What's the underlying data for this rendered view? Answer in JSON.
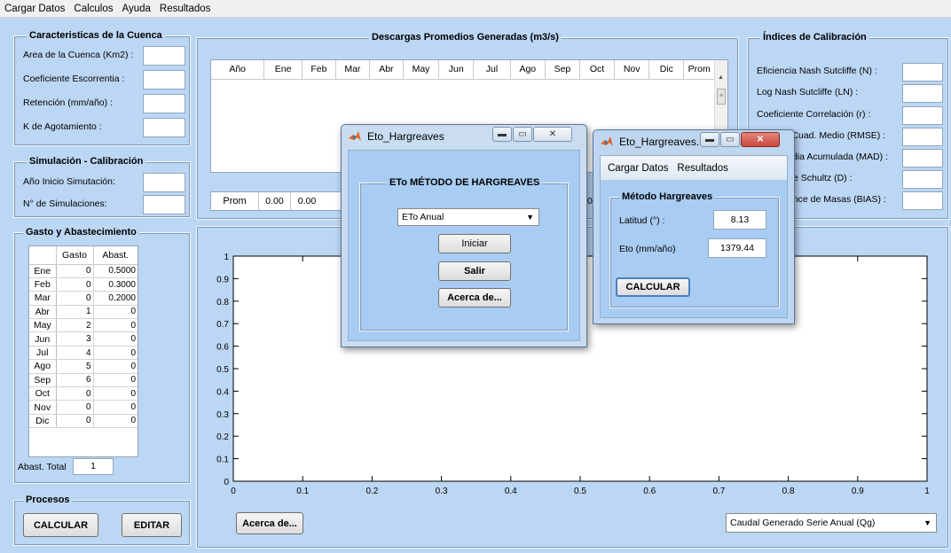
{
  "menubar": [
    "Cargar Datos",
    "Calculos",
    "Ayuda",
    "Resultados"
  ],
  "cuenca": {
    "title": "Caracteristicas de la Cuenca",
    "fields": [
      "Area de la Cuenca (Km2) :",
      "Coeficiente Escorrentia :",
      "Retención (mm/año) :",
      "K de Agotamiento :"
    ]
  },
  "simulacion": {
    "title": "Simulación - Calibración",
    "fields": [
      "Año Inicio Simutación:",
      "N° de Simulaciones:"
    ]
  },
  "gasto": {
    "title": "Gasto y Abastecimiento",
    "columns": [
      "Gasto",
      "Abast."
    ],
    "rows": [
      {
        "m": "Ene",
        "g": "0",
        "a": "0.5000"
      },
      {
        "m": "Feb",
        "g": "0",
        "a": "0.3000"
      },
      {
        "m": "Mar",
        "g": "0",
        "a": "0.2000"
      },
      {
        "m": "Abr",
        "g": "1",
        "a": "0"
      },
      {
        "m": "May",
        "g": "2",
        "a": "0"
      },
      {
        "m": "Jun",
        "g": "3",
        "a": "0"
      },
      {
        "m": "Jul",
        "g": "4",
        "a": "0"
      },
      {
        "m": "Ago",
        "g": "5",
        "a": "0"
      },
      {
        "m": "Sep",
        "g": "6",
        "a": "0"
      },
      {
        "m": "Oct",
        "g": "0",
        "a": "0"
      },
      {
        "m": "Nov",
        "g": "0",
        "a": "0"
      },
      {
        "m": "Dic",
        "g": "0",
        "a": "0"
      }
    ],
    "total_label": "Abast. Total",
    "total_value": "1"
  },
  "procesos": {
    "title": "Procesos",
    "calcular": "CALCULAR",
    "editar": "EDITAR"
  },
  "descargas": {
    "title": "Descargas Promedios Generadas (m3/s)",
    "columns": [
      "Año",
      "Ene",
      "Feb",
      "Mar",
      "Abr",
      "May",
      "Jun",
      "Jul",
      "Ago",
      "Sep",
      "Oct",
      "Nov",
      "Dic",
      "Prom"
    ],
    "prom_label": "Prom",
    "prom_values": [
      "0.00",
      "0.00"
    ],
    "partial_value": "0"
  },
  "indices": {
    "title": "Índices de Calibración",
    "fields": [
      "Eficiencia Nash Sutcliffe (N) :",
      "Log Nash Sutcliffe (LN) :",
      "Coeficiente Correlación (r) :",
      "r Cuad. Medio (RMSE) :",
      "dia Acumulada (MAD) :",
      "e Schultz (D) :",
      "ance de Masas (BIAS) :"
    ]
  },
  "plot": {
    "y_ticks": [
      "0",
      "0.1",
      "0.2",
      "0.3",
      "0.4",
      "0.5",
      "0.6",
      "0.7",
      "0.8",
      "0.9",
      "1"
    ],
    "x_ticks": [
      "0",
      "0.1",
      "0.2",
      "0.3",
      "0.4",
      "0.5",
      "0.6",
      "0.7",
      "0.8",
      "0.9",
      "1"
    ]
  },
  "acerca_button": "Acerca de...",
  "serie_select": "Caudal Generado Serie Anual (Qg)",
  "win1": {
    "title": "Eto_Hargreaves",
    "group_title": "ETo MÉTODO DE HARGREAVES",
    "select_value": "ETo Anual",
    "iniciar": "Iniciar",
    "salir": "Salir",
    "acerca": "Acerca de..."
  },
  "win2": {
    "title": "Eto_Hargreaves...",
    "menu": [
      "Cargar Datos",
      "Resultados"
    ],
    "group_title": "Método Hargreaves",
    "latitud_label": "Latitud (°) :",
    "latitud_value": "8.13",
    "eto_label": "Eto (mm/año)",
    "eto_value": "1379.44",
    "calcular": "CALCULAR"
  },
  "colors": {
    "background": "#bcd7f4",
    "close_button": "#c9463d"
  }
}
